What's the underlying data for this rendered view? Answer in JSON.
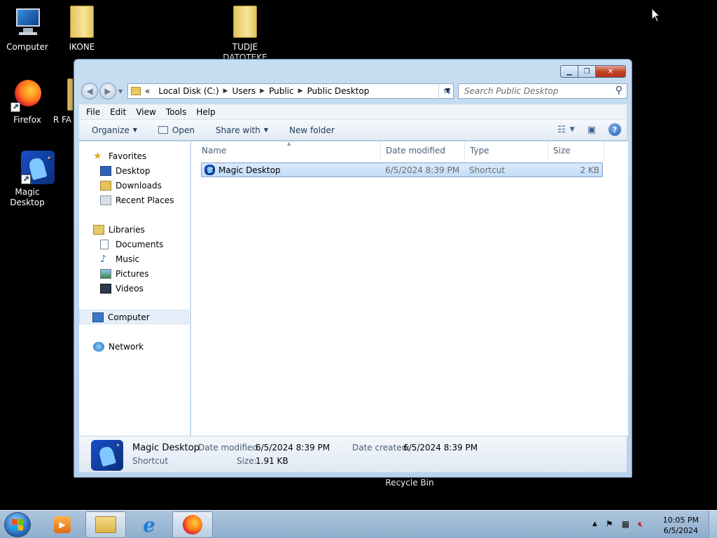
{
  "desktop": {
    "icons": [
      {
        "label": "Computer"
      },
      {
        "label": "IKONE"
      },
      {
        "label": "TUDJE DATOTEKE"
      },
      {
        "label": "Firefox"
      },
      {
        "label": "R FA"
      },
      {
        "label": "Magic Desktop"
      }
    ],
    "recycle_bin_label": "Recycle Bin"
  },
  "window": {
    "breadcrumb": {
      "overflow": "«",
      "items": [
        "Local Disk (C:)",
        "Users",
        "Public",
        "Public Desktop"
      ]
    },
    "search_placeholder": "Search Public Desktop",
    "menu": [
      "File",
      "Edit",
      "View",
      "Tools",
      "Help"
    ],
    "toolbar": {
      "organize": "Organize",
      "open": "Open",
      "share_with": "Share with",
      "new_folder": "New folder"
    },
    "nav": {
      "favorites": "Favorites",
      "favorites_items": [
        "Desktop",
        "Downloads",
        "Recent Places"
      ],
      "libraries": "Libraries",
      "libraries_items": [
        "Documents",
        "Music",
        "Pictures",
        "Videos"
      ],
      "computer": "Computer",
      "network": "Network"
    },
    "columns": [
      "Name",
      "Date modified",
      "Type",
      "Size"
    ],
    "files": [
      {
        "name": "Magic Desktop",
        "date_modified": "6/5/2024 8:39 PM",
        "type": "Shortcut",
        "size": "2 KB"
      }
    ],
    "details": {
      "name": "Magic Desktop",
      "kind": "Shortcut",
      "date_modified_label": "Date modified:",
      "date_modified": "6/5/2024 8:39 PM",
      "size_label": "Size:",
      "size": "1.91 KB",
      "date_created_label": "Date created:",
      "date_created": "6/5/2024 8:39 PM"
    }
  },
  "taskbar": {
    "time": "10:05 PM",
    "date": "6/5/2024"
  },
  "colors": {
    "selection": "#cfe3fb",
    "titlebar": "#c6dcf1",
    "close": "#c3452b"
  }
}
